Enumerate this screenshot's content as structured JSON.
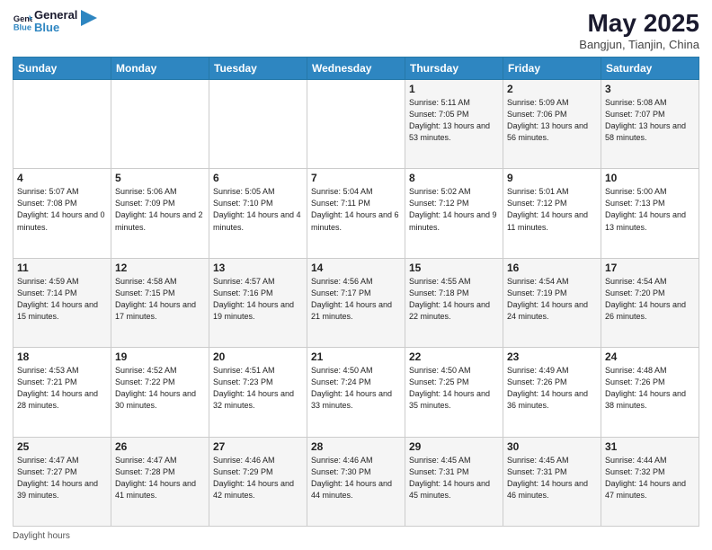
{
  "header": {
    "logo_line1": "General",
    "logo_line2": "Blue",
    "title": "May 2025",
    "subtitle": "Bangjun, Tianjin, China"
  },
  "days_of_week": [
    "Sunday",
    "Monday",
    "Tuesday",
    "Wednesday",
    "Thursday",
    "Friday",
    "Saturday"
  ],
  "weeks": [
    [
      {
        "day": "",
        "sunrise": "",
        "sunset": "",
        "daylight": ""
      },
      {
        "day": "",
        "sunrise": "",
        "sunset": "",
        "daylight": ""
      },
      {
        "day": "",
        "sunrise": "",
        "sunset": "",
        "daylight": ""
      },
      {
        "day": "",
        "sunrise": "",
        "sunset": "",
        "daylight": ""
      },
      {
        "day": "1",
        "sunrise": "Sunrise: 5:11 AM",
        "sunset": "Sunset: 7:05 PM",
        "daylight": "Daylight: 13 hours and 53 minutes."
      },
      {
        "day": "2",
        "sunrise": "Sunrise: 5:09 AM",
        "sunset": "Sunset: 7:06 PM",
        "daylight": "Daylight: 13 hours and 56 minutes."
      },
      {
        "day": "3",
        "sunrise": "Sunrise: 5:08 AM",
        "sunset": "Sunset: 7:07 PM",
        "daylight": "Daylight: 13 hours and 58 minutes."
      }
    ],
    [
      {
        "day": "4",
        "sunrise": "Sunrise: 5:07 AM",
        "sunset": "Sunset: 7:08 PM",
        "daylight": "Daylight: 14 hours and 0 minutes."
      },
      {
        "day": "5",
        "sunrise": "Sunrise: 5:06 AM",
        "sunset": "Sunset: 7:09 PM",
        "daylight": "Daylight: 14 hours and 2 minutes."
      },
      {
        "day": "6",
        "sunrise": "Sunrise: 5:05 AM",
        "sunset": "Sunset: 7:10 PM",
        "daylight": "Daylight: 14 hours and 4 minutes."
      },
      {
        "day": "7",
        "sunrise": "Sunrise: 5:04 AM",
        "sunset": "Sunset: 7:11 PM",
        "daylight": "Daylight: 14 hours and 6 minutes."
      },
      {
        "day": "8",
        "sunrise": "Sunrise: 5:02 AM",
        "sunset": "Sunset: 7:12 PM",
        "daylight": "Daylight: 14 hours and 9 minutes."
      },
      {
        "day": "9",
        "sunrise": "Sunrise: 5:01 AM",
        "sunset": "Sunset: 7:12 PM",
        "daylight": "Daylight: 14 hours and 11 minutes."
      },
      {
        "day": "10",
        "sunrise": "Sunrise: 5:00 AM",
        "sunset": "Sunset: 7:13 PM",
        "daylight": "Daylight: 14 hours and 13 minutes."
      }
    ],
    [
      {
        "day": "11",
        "sunrise": "Sunrise: 4:59 AM",
        "sunset": "Sunset: 7:14 PM",
        "daylight": "Daylight: 14 hours and 15 minutes."
      },
      {
        "day": "12",
        "sunrise": "Sunrise: 4:58 AM",
        "sunset": "Sunset: 7:15 PM",
        "daylight": "Daylight: 14 hours and 17 minutes."
      },
      {
        "day": "13",
        "sunrise": "Sunrise: 4:57 AM",
        "sunset": "Sunset: 7:16 PM",
        "daylight": "Daylight: 14 hours and 19 minutes."
      },
      {
        "day": "14",
        "sunrise": "Sunrise: 4:56 AM",
        "sunset": "Sunset: 7:17 PM",
        "daylight": "Daylight: 14 hours and 21 minutes."
      },
      {
        "day": "15",
        "sunrise": "Sunrise: 4:55 AM",
        "sunset": "Sunset: 7:18 PM",
        "daylight": "Daylight: 14 hours and 22 minutes."
      },
      {
        "day": "16",
        "sunrise": "Sunrise: 4:54 AM",
        "sunset": "Sunset: 7:19 PM",
        "daylight": "Daylight: 14 hours and 24 minutes."
      },
      {
        "day": "17",
        "sunrise": "Sunrise: 4:54 AM",
        "sunset": "Sunset: 7:20 PM",
        "daylight": "Daylight: 14 hours and 26 minutes."
      }
    ],
    [
      {
        "day": "18",
        "sunrise": "Sunrise: 4:53 AM",
        "sunset": "Sunset: 7:21 PM",
        "daylight": "Daylight: 14 hours and 28 minutes."
      },
      {
        "day": "19",
        "sunrise": "Sunrise: 4:52 AM",
        "sunset": "Sunset: 7:22 PM",
        "daylight": "Daylight: 14 hours and 30 minutes."
      },
      {
        "day": "20",
        "sunrise": "Sunrise: 4:51 AM",
        "sunset": "Sunset: 7:23 PM",
        "daylight": "Daylight: 14 hours and 32 minutes."
      },
      {
        "day": "21",
        "sunrise": "Sunrise: 4:50 AM",
        "sunset": "Sunset: 7:24 PM",
        "daylight": "Daylight: 14 hours and 33 minutes."
      },
      {
        "day": "22",
        "sunrise": "Sunrise: 4:50 AM",
        "sunset": "Sunset: 7:25 PM",
        "daylight": "Daylight: 14 hours and 35 minutes."
      },
      {
        "day": "23",
        "sunrise": "Sunrise: 4:49 AM",
        "sunset": "Sunset: 7:26 PM",
        "daylight": "Daylight: 14 hours and 36 minutes."
      },
      {
        "day": "24",
        "sunrise": "Sunrise: 4:48 AM",
        "sunset": "Sunset: 7:26 PM",
        "daylight": "Daylight: 14 hours and 38 minutes."
      }
    ],
    [
      {
        "day": "25",
        "sunrise": "Sunrise: 4:47 AM",
        "sunset": "Sunset: 7:27 PM",
        "daylight": "Daylight: 14 hours and 39 minutes."
      },
      {
        "day": "26",
        "sunrise": "Sunrise: 4:47 AM",
        "sunset": "Sunset: 7:28 PM",
        "daylight": "Daylight: 14 hours and 41 minutes."
      },
      {
        "day": "27",
        "sunrise": "Sunrise: 4:46 AM",
        "sunset": "Sunset: 7:29 PM",
        "daylight": "Daylight: 14 hours and 42 minutes."
      },
      {
        "day": "28",
        "sunrise": "Sunrise: 4:46 AM",
        "sunset": "Sunset: 7:30 PM",
        "daylight": "Daylight: 14 hours and 44 minutes."
      },
      {
        "day": "29",
        "sunrise": "Sunrise: 4:45 AM",
        "sunset": "Sunset: 7:31 PM",
        "daylight": "Daylight: 14 hours and 45 minutes."
      },
      {
        "day": "30",
        "sunrise": "Sunrise: 4:45 AM",
        "sunset": "Sunset: 7:31 PM",
        "daylight": "Daylight: 14 hours and 46 minutes."
      },
      {
        "day": "31",
        "sunrise": "Sunrise: 4:44 AM",
        "sunset": "Sunset: 7:32 PM",
        "daylight": "Daylight: 14 hours and 47 minutes."
      }
    ]
  ],
  "footer": {
    "text": "Daylight hours"
  }
}
